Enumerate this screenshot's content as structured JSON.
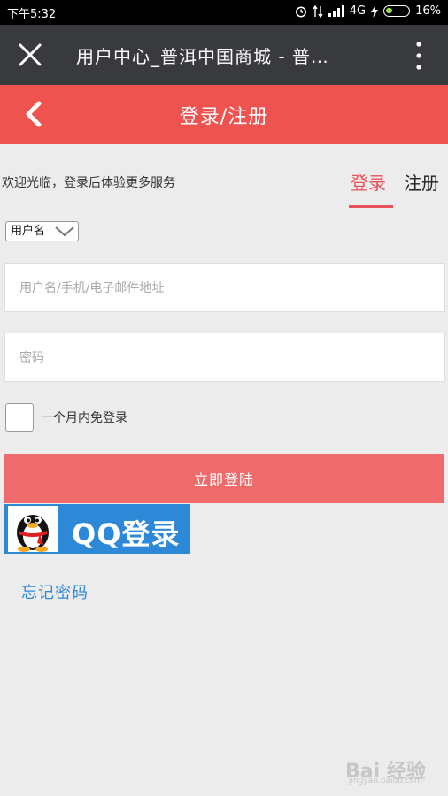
{
  "status_bar": {
    "time": "下午5:32",
    "network": "4G",
    "battery": "16%"
  },
  "wechat_bar": {
    "title": "用户中心_普洱中国商城 - 普…"
  },
  "header": {
    "title": "登录/注册"
  },
  "welcome_text": "欢迎光临，登录后体验更多服务",
  "tabs": {
    "login": "登录",
    "register": "注册"
  },
  "login_type_select": {
    "value": "用户名"
  },
  "username_input": {
    "placeholder": "用户名/手机/电子邮件地址"
  },
  "password_input": {
    "placeholder": "密码"
  },
  "remember": {
    "label": "一个月内免登录"
  },
  "login_button": {
    "label": "立即登陆"
  },
  "qq_login": {
    "label": "QQ登录"
  },
  "forgot_password": "忘记密码",
  "watermark": {
    "text": "Bai 经验",
    "sub": "jingyan.baidu.com"
  },
  "colors": {
    "header": "#ef5350",
    "accent": "#e8525a",
    "login_button": "#ef6b6b",
    "qq_blue": "#2e88d8",
    "background": "#ececec"
  }
}
